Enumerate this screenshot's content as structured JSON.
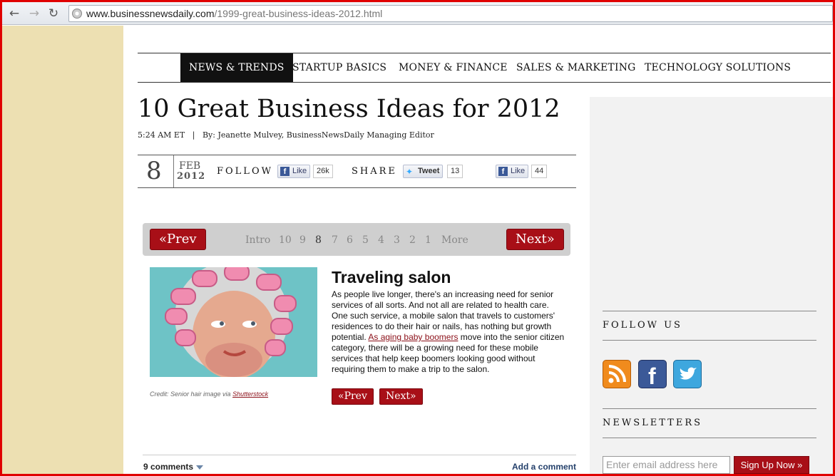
{
  "browser": {
    "url_domain": "www.businessnewsdaily.com",
    "url_path": "/1999-great-business-ideas-2012.html"
  },
  "nav": {
    "items": [
      "NEWS & TRENDS",
      "STARTUP BASICS",
      "MONEY & FINANCE",
      "SALES & MARKETING",
      "TECHNOLOGY SOLUTIONS"
    ],
    "active": "NEWS & TRENDS"
  },
  "article": {
    "title": "10 Great Business Ideas for 2012",
    "byline": "5:24 AM ET   |   By: Jeanette Mulvey, BusinessNewsDaily Managing Editor",
    "date": {
      "day": "8",
      "month": "FEB",
      "year": "2012"
    }
  },
  "sharebar": {
    "follow_label": "FOLLOW",
    "share_label": "SHARE",
    "like_label": "Like",
    "tweet_label": "Tweet",
    "follow_like_count": "26k",
    "tweet_count": "13",
    "share_like_count": "44"
  },
  "pager": {
    "prev": "«Prev",
    "next": "Next»",
    "pages": [
      "Intro",
      "10",
      "9",
      "8",
      "7",
      "6",
      "5",
      "4",
      "3",
      "2",
      "1",
      "More"
    ],
    "current": "8"
  },
  "slide": {
    "title": "Traveling salon",
    "body_before": "As people live longer, there's an increasing need for senior services of all sorts. And not all are related to health care. One such service, a mobile salon that travels to customers' residences to do their hair or nails, has nothing but growth potential. ",
    "body_link": "As aging baby boomers",
    "body_after": " move into the senior citizen category, there will be a growing need for these mobile services that help keep boomers looking good without requiring them to make a trip to the salon.",
    "credit_text": "Credit: Senior hair image via ",
    "credit_link": "Shutterstock",
    "prev": "«Prev",
    "next": "Next»"
  },
  "comments": {
    "count_label": "9 comments",
    "add_label": "Add a comment"
  },
  "sidebar": {
    "follow_us": "FOLLOW US",
    "newsletters": "NEWSLETTERS",
    "email_placeholder": "Enter email address here",
    "signup_label": "Sign Up Now »",
    "icons": [
      "rss-icon",
      "facebook-icon",
      "twitter-icon"
    ]
  },
  "colors": {
    "accent_red": "#a80f17",
    "gutter": "#ede0b2",
    "sidebar_bg": "#f2f2f2"
  }
}
